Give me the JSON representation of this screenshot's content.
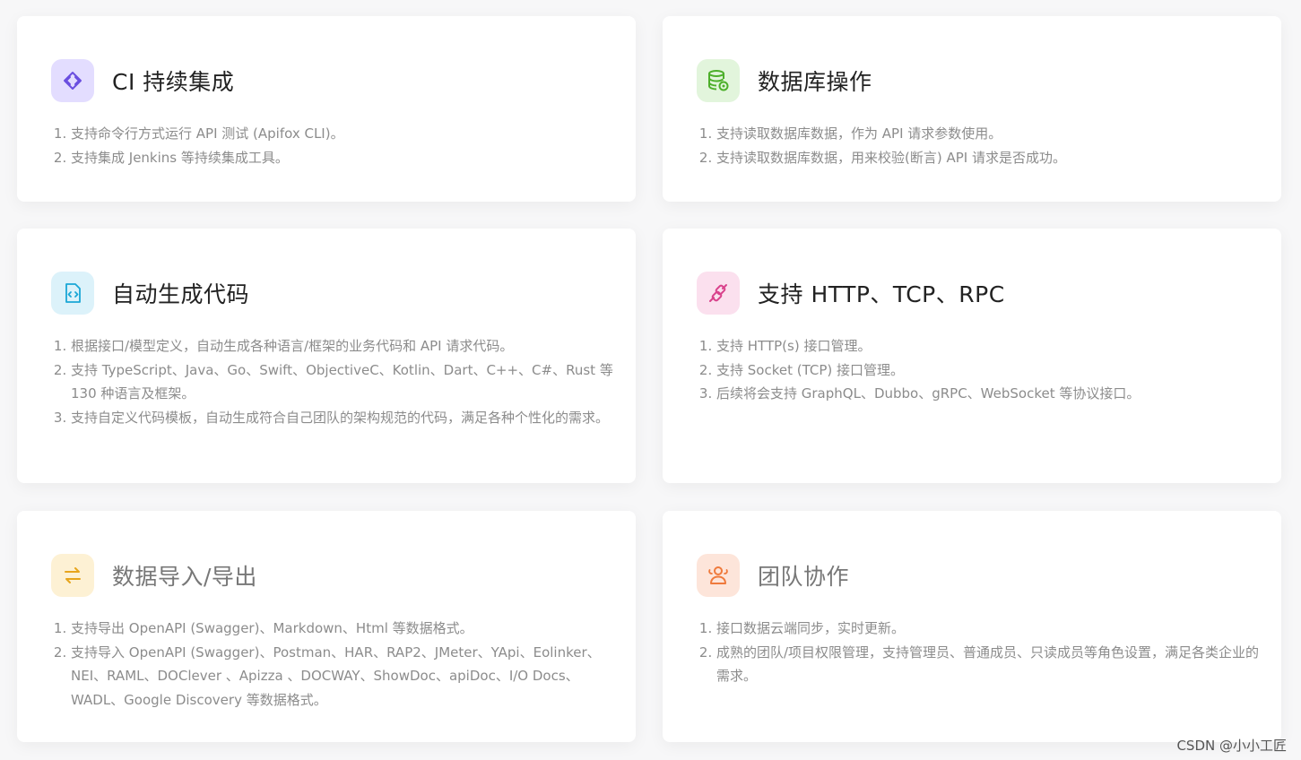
{
  "cards": [
    {
      "title": "CI 持续集成",
      "icon": "code-brackets-icon",
      "icon_color": "#6a4ee0",
      "icon_bg": "#e3ddff",
      "items": [
        "支持命令行方式运行 API 测试 (Apifox CLI)。",
        "支持集成 Jenkins 等持续集成工具。"
      ]
    },
    {
      "title": "数据库操作",
      "icon": "database-icon",
      "icon_color": "#4caf2a",
      "icon_bg": "#e2f5dc",
      "items": [
        "支持读取数据库数据，作为 API 请求参数使用。",
        "支持读取数据库数据，用来校验(断言) API 请求是否成功。"
      ]
    },
    {
      "title": "自动生成代码",
      "icon": "code-file-icon",
      "icon_color": "#1aa7d6",
      "icon_bg": "#dcf2fa",
      "items": [
        "根据接口/模型定义，自动生成各种语言/框架的业务代码和 API 请求代码。",
        "支持 TypeScript、Java、Go、Swift、ObjectiveC、Kotlin、Dart、C++、C#、Rust 等 130 种语言及框架。",
        "支持自定义代码模板，自动生成符合自己团队的架构规范的代码，满足各种个性化的需求。"
      ]
    },
    {
      "title": "支持 HTTP、TCP、RPC",
      "icon": "plug-link-icon",
      "icon_color": "#d9428c",
      "icon_bg": "#fbe0ee",
      "items": [
        "支持 HTTP(s) 接口管理。",
        "支持 Socket (TCP) 接口管理。",
        "后续将会支持 GraphQL、Dubbo、gRPC、WebSocket 等协议接口。"
      ]
    },
    {
      "title": "数据导入/导出",
      "icon": "swap-arrows-icon",
      "icon_color": "#e7a51c",
      "icon_bg": "#fdf1d4",
      "items": [
        "支持导出 OpenAPI (Swagger)、Markdown、Html 等数据格式。",
        "支持导入 OpenAPI (Swagger)、Postman、HAR、RAP2、JMeter、YApi、Eolinker、NEI、RAML、DOClever 、Apizza 、DOCWAY、ShowDoc、apiDoc、I/O Docs、WADL、Google Discovery 等数据格式。"
      ]
    },
    {
      "title": "团队协作",
      "icon": "team-users-icon",
      "icon_color": "#ef7a3c",
      "icon_bg": "#fde5da",
      "items": [
        "接口数据云端同步，实时更新。",
        "成熟的团队/项目权限管理，支持管理员、普通成员、只读成员等角色设置，满足各类企业的需求。"
      ]
    }
  ],
  "watermark": "CSDN @小小工匠"
}
